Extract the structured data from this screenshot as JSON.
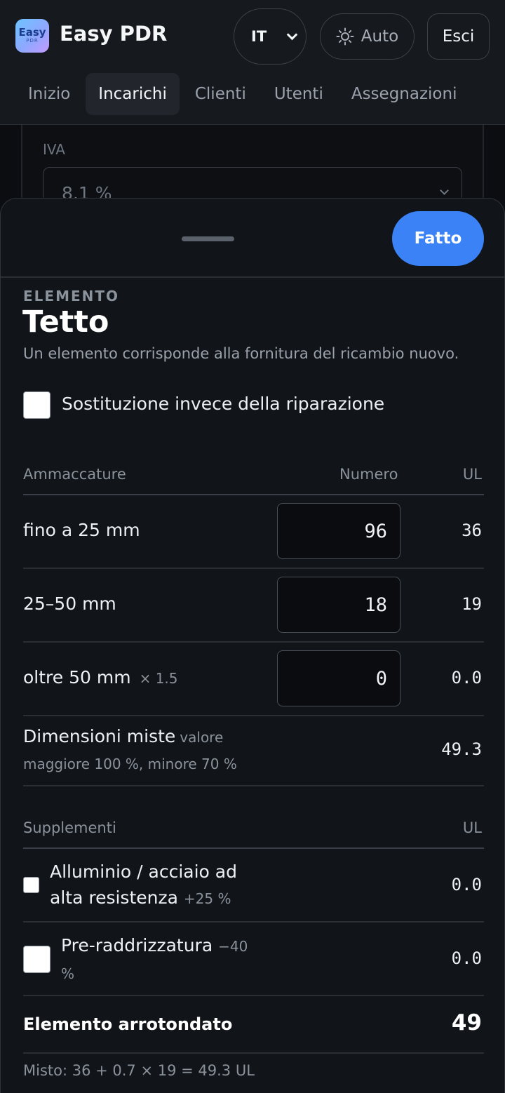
{
  "app": {
    "logo_line1": "Easy",
    "logo_line2": "PDR",
    "title": "Easy PDR"
  },
  "header": {
    "language": "IT",
    "theme_label": "Auto",
    "exit_label": "Esci"
  },
  "nav": {
    "items": [
      {
        "label": "Inizio",
        "active": false
      },
      {
        "label": "Incarichi",
        "active": true
      },
      {
        "label": "Clienti",
        "active": false
      },
      {
        "label": "Utenti",
        "active": false
      },
      {
        "label": "Assegnazioni",
        "active": false
      }
    ]
  },
  "background_form": {
    "vat_label": "IVA",
    "vat_value": "8.1 %"
  },
  "sheet": {
    "done_label": "Fatto",
    "kicker": "ELEMENTO",
    "title": "Tetto",
    "subtitle": "Un elemento corrisponde alla fornitura del ricambio nuovo.",
    "replacement_label": "Sostituzione invece della riparazione",
    "replacement_checked": false,
    "dents_table": {
      "headers": {
        "type": "Ammaccature",
        "count": "Numero",
        "ul": "UL"
      },
      "rows": [
        {
          "label": "fino a 25 mm",
          "multiplier": "",
          "count": "96",
          "ul": "36"
        },
        {
          "label": "25–50 mm",
          "multiplier": "",
          "count": "18",
          "ul": "19"
        },
        {
          "label": "oltre 50 mm",
          "multiplier": "× 1.5",
          "count": "0",
          "ul": "0.0"
        }
      ],
      "mixed": {
        "label": "Dimensioni miste",
        "label_small": "valore",
        "detail": "maggiore 100 %, minore 70 %",
        "ul": "49.3"
      }
    },
    "supplements": {
      "headers": {
        "type": "Supplementi",
        "ul": "UL"
      },
      "items": [
        {
          "label": "Alluminio / acciaio ad alta resistenza",
          "pct": "+25 %",
          "checked": false,
          "ul": "0.0"
        },
        {
          "label": "Pre-raddrizzatura",
          "pct": "−40 %",
          "checked": false,
          "ul": "0.0"
        }
      ]
    },
    "total": {
      "label": "Elemento arrotondato",
      "value": "49"
    },
    "formula": "Misto: 36 + 0.7 × 19 = 49.3 UL"
  }
}
